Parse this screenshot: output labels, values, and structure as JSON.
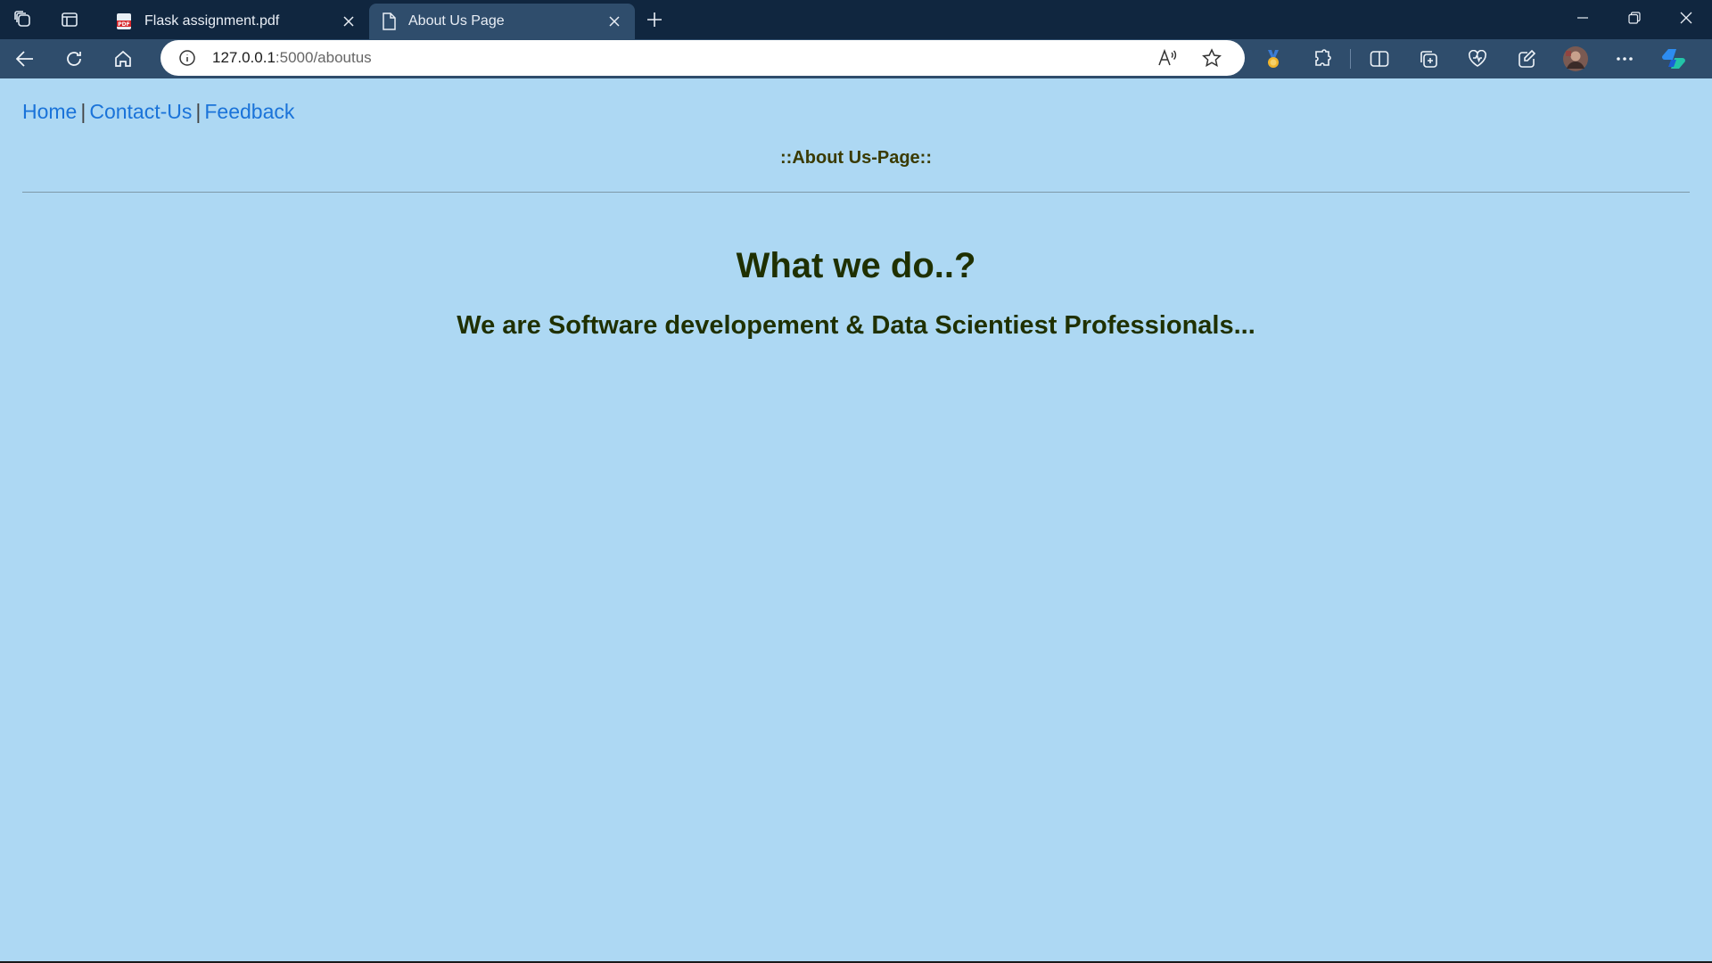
{
  "browser": {
    "tabs": [
      {
        "label": "Flask assignment.pdf",
        "icon": "pdf-file-icon",
        "active": false
      },
      {
        "label": "About Us Page",
        "icon": "page-icon",
        "active": true
      }
    ],
    "url": {
      "host": "127.0.0.1",
      "path": ":5000/aboutus"
    }
  },
  "page": {
    "nav_links": [
      "Home",
      "Contact-Us",
      "Feedback"
    ],
    "nav_separator": "|",
    "page_tag": "::About Us-Page::",
    "heading": "What we do..?",
    "subheading": "We are Software developement & Data Scientiest Professionals..."
  },
  "colors": {
    "page_background": "#add8f3",
    "link": "#1a73d9",
    "heading_text": "#1f3000",
    "tab_strip": "#10263f",
    "toolbar": "#2f4d6c"
  }
}
